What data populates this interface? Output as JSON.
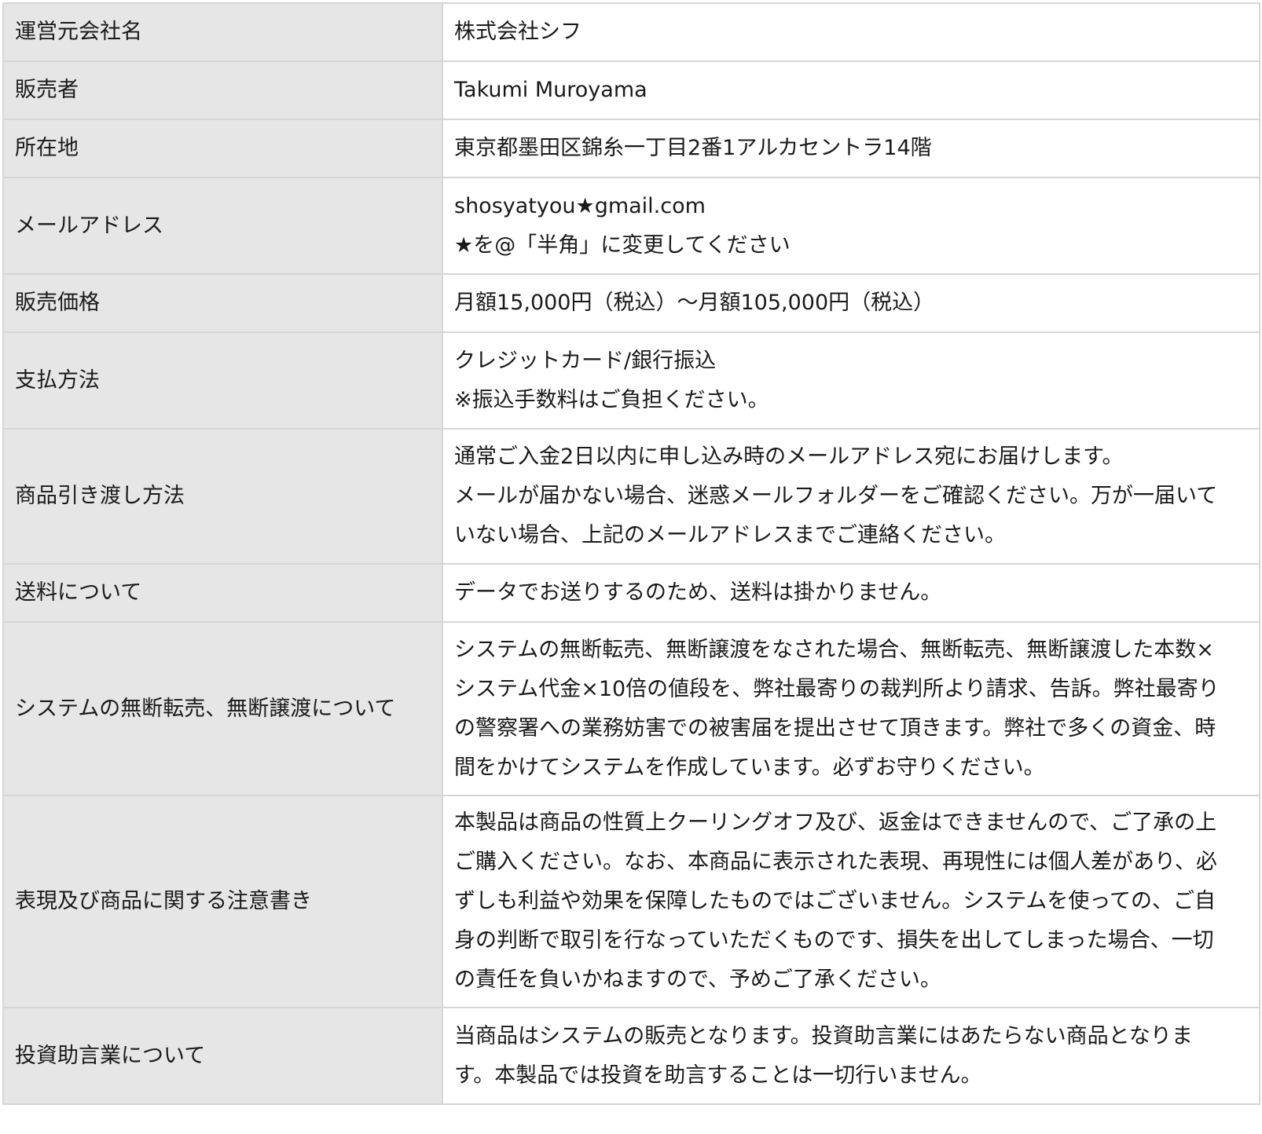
{
  "table": {
    "rows": [
      {
        "label": "運営元会社名",
        "lines": [
          "株式会社シフ"
        ]
      },
      {
        "label": "販売者",
        "lines": [
          "Takumi Muroyama"
        ]
      },
      {
        "label": "所在地",
        "lines": [
          "東京都墨田区錦糸一丁目2番1アルカセントラ14階"
        ]
      },
      {
        "label": "メールアドレス",
        "lines": [
          "shosyatyou★gmail.com",
          "★を@「半角」に変更してください"
        ]
      },
      {
        "label": "販売価格",
        "lines": [
          "月額15,000円（税込）～月額105,000円（税込）"
        ]
      },
      {
        "label": "支払方法",
        "lines": [
          "クレジットカード/銀行振込",
          "※振込手数料はご負担ください。"
        ]
      },
      {
        "label": "商品引き渡し方法",
        "lines": [
          "通常ご入金2日以内に申し込み時のメールアドレス宛にお届けします。",
          "メールが届かない場合、迷惑メールフォルダーをご確認ください。万が一届いて",
          "いない場合、上記のメールアドレスまでご連絡ください。"
        ]
      },
      {
        "label": "送料について",
        "lines": [
          "データでお送りするのため、送料は掛かりません。"
        ]
      },
      {
        "label": "システムの無断転売、無断譲渡について",
        "lines": [
          "システムの無断転売、無断譲渡をなされた場合、無断転売、無断譲渡した本数×",
          "システム代金×10倍の値段を、弊社最寄りの裁判所より請求、告訴。弊社最寄り",
          "の警察署への業務妨害での被害届を提出させて頂きます。弊社で多くの資金、時",
          "間をかけてシステムを作成しています。必ずお守りください。"
        ]
      },
      {
        "label": "表現及び商品に関する注意書き",
        "lines": [
          "本製品は商品の性質上クーリングオフ及び、返金はできませんので、ご了承の上",
          "ご購入ください。なお、本商品に表示された表現、再現性には個人差があり、必",
          "ずしも利益や効果を保障したものではございません。システムを使っての、ご自",
          "身の判断で取引を行なっていただくものです、損失を出してしまった場合、一切",
          "の責任を負いかねますので、予めご了承ください。"
        ]
      },
      {
        "label": "投資助言業について",
        "lines": [
          "当商品はシステムの販売となります。投資助言業にはあたらない商品となりま",
          "す。本製品では投資を助言することは一切行いません。"
        ]
      }
    ]
  }
}
